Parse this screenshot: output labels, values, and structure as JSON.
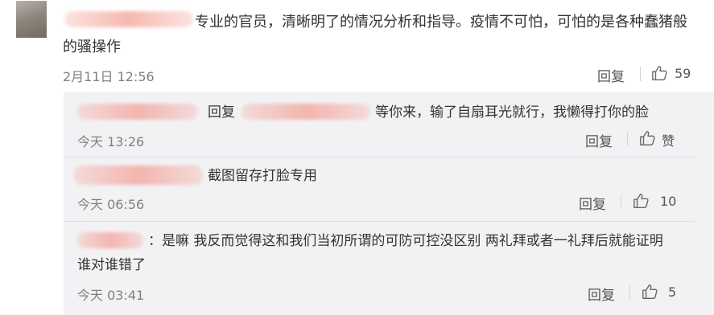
{
  "main_comment": {
    "text": "专业的官员，清晰明了的情况分析和指导。疫情不可怕，可怕的是各种蠢猪般的骚操作",
    "timestamp": "2月11日 12:56",
    "reply_label": "回复",
    "like_count": "59"
  },
  "replies": [
    {
      "reply_word": "回复",
      "text": "等你来，输了自扇耳光就行，我懒得打你的脸",
      "timestamp": "今天 13:26",
      "reply_label": "回复",
      "like_label": "赞"
    },
    {
      "text": "截图留存打脸专用",
      "timestamp": "今天 06:56",
      "reply_label": "回复",
      "like_count": "10"
    },
    {
      "text": "：是嘛 我反而觉得这和我们当初所谓的可防可控没区别 两礼拜或者一礼拜后就能证明谁对谁错了",
      "timestamp": "今天 03:41",
      "reply_label": "回复",
      "like_count": "5"
    }
  ],
  "colors": {
    "replies_bg": "#f2f2f5",
    "blur_name": "#f3a096",
    "meta_text": "#808080"
  },
  "icons": {
    "like": "thumbs-up-icon"
  }
}
